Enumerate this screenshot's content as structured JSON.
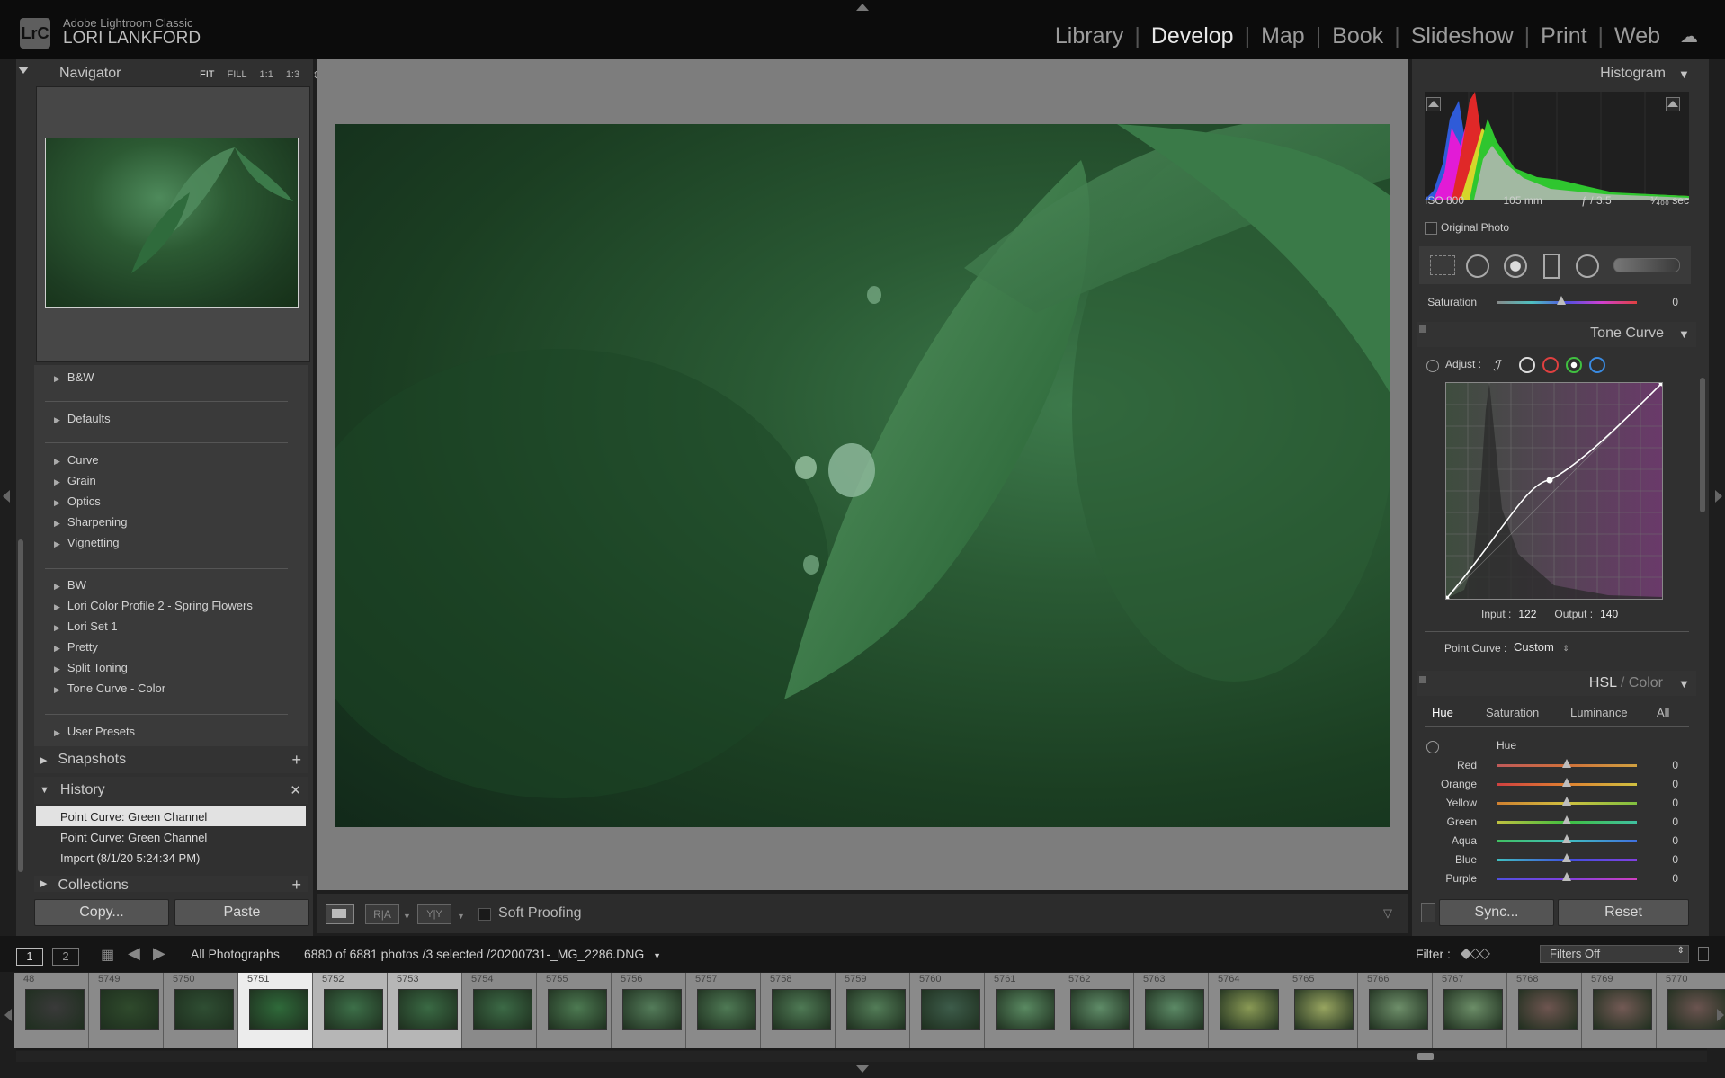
{
  "app": {
    "product": "Adobe Lightroom Classic",
    "user": "LORI LANKFORD",
    "logo": "LrC"
  },
  "modules": [
    "Library",
    "Develop",
    "Map",
    "Book",
    "Slideshow",
    "Print",
    "Web"
  ],
  "active_module": "Develop",
  "navigator": {
    "title": "Navigator",
    "zoom_options": [
      "FIT",
      "FILL",
      "1:1",
      "1:3"
    ]
  },
  "presets": {
    "group1": [
      "B&W"
    ],
    "group2": [
      "Defaults"
    ],
    "group3": [
      "Curve",
      "Grain",
      "Optics",
      "Sharpening",
      "Vignetting"
    ],
    "group4": [
      "BW",
      "Lori Color Profile 2 - Spring Flowers",
      "Lori Set 1",
      "Pretty",
      "Split Toning",
      "Tone Curve - Color"
    ],
    "group5": [
      "User Presets"
    ]
  },
  "snapshots": {
    "title": "Snapshots"
  },
  "history": {
    "title": "History",
    "items": [
      "Point Curve: Green Channel",
      "Point Curve: Green Channel",
      "Import (8/1/20 5:24:34 PM)"
    ]
  },
  "collections": {
    "title": "Collections"
  },
  "left_buttons": {
    "copy": "Copy...",
    "paste": "Paste"
  },
  "toolbar": {
    "soft_proofing": "Soft Proofing"
  },
  "histogram": {
    "title": "Histogram",
    "iso": "ISO 800",
    "focal": "105 mm",
    "aperture": "ƒ / 3.5",
    "shutter": "¹⁄₄₀₀ sec",
    "original_photo": "Original Photo"
  },
  "saturation_row": {
    "label": "Saturation",
    "value": "0"
  },
  "tone_curve": {
    "title": "Tone Curve",
    "adjust_label": "Adjust :",
    "input_label": "Input :",
    "input_value": "122",
    "output_label": "Output :",
    "output_value": "140",
    "point_curve_label": "Point Curve :",
    "point_curve_value": "Custom"
  },
  "hsl": {
    "title_a": "HSL",
    "title_sep": " / ",
    "title_b": "Color",
    "tabs": [
      "Hue",
      "Saturation",
      "Luminance",
      "All"
    ],
    "section": "Hue",
    "rows": [
      {
        "label": "Red",
        "value": "0",
        "position": 0.5
      },
      {
        "label": "Orange",
        "value": "0",
        "position": 0.5
      },
      {
        "label": "Yellow",
        "value": "0",
        "position": 0.5
      },
      {
        "label": "Green",
        "value": "0",
        "position": 0.5
      },
      {
        "label": "Aqua",
        "value": "0",
        "position": 0.5
      },
      {
        "label": "Blue",
        "value": "0",
        "position": 0.5
      },
      {
        "label": "Purple",
        "value": "0",
        "position": 0.5
      }
    ]
  },
  "right_buttons": {
    "sync": "Sync...",
    "reset": "Reset"
  },
  "filmbar": {
    "page1": "1",
    "page2": "2",
    "source": "All Photographs",
    "info": "6880 of 6881 photos /3 selected /20200731-_MG_2286.DNG",
    "filter_label": "Filter :",
    "filter_value": "Filters Off"
  },
  "filmstrip": [
    {
      "num": "48",
      "c": "#3a3a3a"
    },
    {
      "num": "5749",
      "c": "#2f4a2c"
    },
    {
      "num": "5750",
      "c": "#2f4e33"
    },
    {
      "num": "5751",
      "c": "#2f6a3a"
    },
    {
      "num": "5752",
      "c": "#3d7049"
    },
    {
      "num": "5753",
      "c": "#3a6a44"
    },
    {
      "num": "5754",
      "c": "#3c6a46"
    },
    {
      "num": "5755",
      "c": "#4d7a52"
    },
    {
      "num": "5756",
      "c": "#547c5a"
    },
    {
      "num": "5757",
      "c": "#4f7a55"
    },
    {
      "num": "5758",
      "c": "#4f7a55"
    },
    {
      "num": "5759",
      "c": "#537d58"
    },
    {
      "num": "5760",
      "c": "#3d5c4a"
    },
    {
      "num": "5761",
      "c": "#5a8a62"
    },
    {
      "num": "5762",
      "c": "#5f8c68"
    },
    {
      "num": "5763",
      "c": "#5c8a66"
    },
    {
      "num": "5764",
      "c": "#8a9a55"
    },
    {
      "num": "5765",
      "c": "#98a560"
    },
    {
      "num": "5766",
      "c": "#6e8f6a"
    },
    {
      "num": "5767",
      "c": "#6c8e68"
    },
    {
      "num": "5768",
      "c": "#6e5550"
    },
    {
      "num": "5769",
      "c": "#735a55"
    },
    {
      "num": "5770",
      "c": "#6b5450"
    }
  ],
  "filmstrip_selection": {
    "active": "5751",
    "selected": [
      "5752",
      "5753"
    ]
  }
}
